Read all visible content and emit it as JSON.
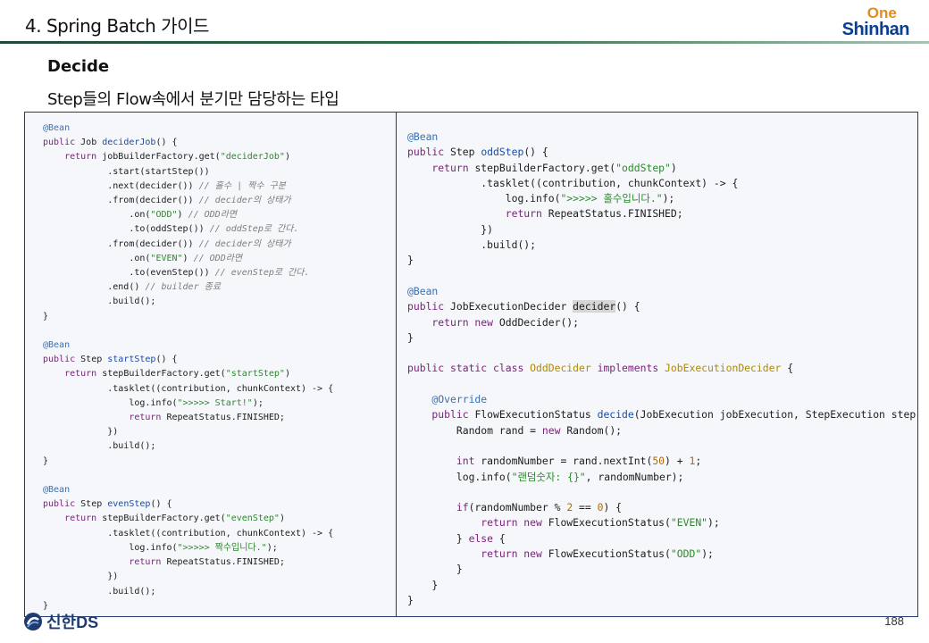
{
  "header": {
    "title": "4. Spring Batch 가이드",
    "logo_top": "One",
    "logo_bottom": "Shinhan",
    "rule_color": "#2f6e4c"
  },
  "section": {
    "heading": "Decide",
    "subtitle": "Step들의 Flow속에서 분기만 담당하는 타입"
  },
  "code_left": [
    [
      [
        "@Bean",
        "ann"
      ]
    ],
    [
      [
        "public ",
        "kw"
      ],
      [
        "Job ",
        ""
      ],
      [
        "deciderJob",
        "fn"
      ],
      [
        "() {",
        ""
      ]
    ],
    [
      [
        "    return ",
        "kw"
      ],
      [
        "jobBuilderFactory.get(",
        ""
      ],
      [
        "\"deciderJob\"",
        "str"
      ],
      [
        ")",
        ""
      ]
    ],
    [
      [
        "            .start(startStep())",
        ""
      ]
    ],
    [
      [
        "            .next(decider()) ",
        ""
      ],
      [
        "// 홀수 | 짝수 구분",
        "cmt"
      ]
    ],
    [
      [
        "            .from(decider()) ",
        ""
      ],
      [
        "// decider의 상태가",
        "cmt"
      ]
    ],
    [
      [
        "                .on(",
        ""
      ],
      [
        "\"ODD\"",
        "str"
      ],
      [
        ") ",
        ""
      ],
      [
        "// ODD라면",
        "cmt"
      ]
    ],
    [
      [
        "                .to(oddStep()) ",
        ""
      ],
      [
        "// oddStep로 간다.",
        "cmt"
      ]
    ],
    [
      [
        "            .from(decider()) ",
        ""
      ],
      [
        "// decider의 상태가",
        "cmt"
      ]
    ],
    [
      [
        "                .on(",
        ""
      ],
      [
        "\"EVEN\"",
        "str"
      ],
      [
        ") ",
        ""
      ],
      [
        "// ODD라면",
        "cmt"
      ]
    ],
    [
      [
        "                .to(evenStep()) ",
        ""
      ],
      [
        "// evenStep로 간다.",
        "cmt"
      ]
    ],
    [
      [
        "            .end() ",
        ""
      ],
      [
        "// builder 종료",
        "cmt"
      ]
    ],
    [
      [
        "            .build();",
        ""
      ]
    ],
    [
      [
        "}",
        ""
      ]
    ],
    [
      [
        "",
        ""
      ]
    ],
    [
      [
        "@Bean",
        "ann"
      ]
    ],
    [
      [
        "public ",
        "kw"
      ],
      [
        "Step ",
        ""
      ],
      [
        "startStep",
        "fn"
      ],
      [
        "() {",
        ""
      ]
    ],
    [
      [
        "    return ",
        "kw"
      ],
      [
        "stepBuilderFactory.get(",
        ""
      ],
      [
        "\"startStep\"",
        "str"
      ],
      [
        ")",
        ""
      ]
    ],
    [
      [
        "            .tasklet((contribution, chunkContext) -> {",
        ""
      ]
    ],
    [
      [
        "                log.info(",
        ""
      ],
      [
        "\">>>>> Start!\"",
        "str"
      ],
      [
        ");",
        ""
      ]
    ],
    [
      [
        "                return ",
        "kw"
      ],
      [
        "RepeatStatus.FINISHED;",
        ""
      ]
    ],
    [
      [
        "            })",
        ""
      ]
    ],
    [
      [
        "            .build();",
        ""
      ]
    ],
    [
      [
        "}",
        ""
      ]
    ],
    [
      [
        "",
        ""
      ]
    ],
    [
      [
        "@Bean",
        "ann"
      ]
    ],
    [
      [
        "public ",
        "kw"
      ],
      [
        "Step ",
        ""
      ],
      [
        "evenStep",
        "fn"
      ],
      [
        "() {",
        ""
      ]
    ],
    [
      [
        "    return ",
        "kw"
      ],
      [
        "stepBuilderFactory.get(",
        ""
      ],
      [
        "\"evenStep\"",
        "str"
      ],
      [
        ")",
        ""
      ]
    ],
    [
      [
        "            .tasklet((contribution, chunkContext) -> {",
        ""
      ]
    ],
    [
      [
        "                log.info(",
        ""
      ],
      [
        "\">>>>> 짝수입니다.\"",
        "str"
      ],
      [
        ");",
        ""
      ]
    ],
    [
      [
        "                return ",
        "kw"
      ],
      [
        "RepeatStatus.FINISHED;",
        ""
      ]
    ],
    [
      [
        "            })",
        ""
      ]
    ],
    [
      [
        "            .build();",
        ""
      ]
    ],
    [
      [
        "}",
        ""
      ]
    ]
  ],
  "code_right": [
    [
      [
        "@Bean",
        "ann"
      ]
    ],
    [
      [
        "public ",
        "kw"
      ],
      [
        "Step ",
        ""
      ],
      [
        "oddStep",
        "fn"
      ],
      [
        "() {",
        ""
      ]
    ],
    [
      [
        "    return ",
        "kw"
      ],
      [
        "stepBuilderFactory.get(",
        ""
      ],
      [
        "\"oddStep\"",
        "str"
      ],
      [
        ")",
        ""
      ]
    ],
    [
      [
        "            .tasklet((contribution, chunkContext) -> {",
        ""
      ]
    ],
    [
      [
        "                log.info(",
        ""
      ],
      [
        "\">>>>> 홀수입니다.\"",
        "str"
      ],
      [
        ");",
        ""
      ]
    ],
    [
      [
        "                return ",
        "kw"
      ],
      [
        "RepeatStatus.FINISHED;",
        ""
      ]
    ],
    [
      [
        "            })",
        ""
      ]
    ],
    [
      [
        "            .build();",
        ""
      ]
    ],
    [
      [
        "}",
        ""
      ]
    ],
    [
      [
        "",
        ""
      ]
    ],
    [
      [
        "@Bean",
        "ann"
      ]
    ],
    [
      [
        "public ",
        "kw"
      ],
      [
        "JobExecutionDecider ",
        ""
      ],
      [
        "decider",
        "hl"
      ],
      [
        "() {",
        ""
      ]
    ],
    [
      [
        "    return new ",
        "kw"
      ],
      [
        "OddDecider();",
        ""
      ]
    ],
    [
      [
        "}",
        ""
      ]
    ],
    [
      [
        "",
        ""
      ]
    ],
    [
      [
        "public static class ",
        "kw"
      ],
      [
        "OddDecider ",
        "cls"
      ],
      [
        "implements ",
        "kw"
      ],
      [
        "JobExecutionDecider ",
        "cls"
      ],
      [
        "{",
        ""
      ]
    ],
    [
      [
        "",
        ""
      ]
    ],
    [
      [
        "    @Override",
        "ann"
      ]
    ],
    [
      [
        "    public ",
        "kw"
      ],
      [
        "FlowExecutionStatus ",
        ""
      ],
      [
        "decide",
        "fn"
      ],
      [
        "(JobExecution jobExecution, StepExecution stepExecution) {",
        ""
      ]
    ],
    [
      [
        "        Random rand = ",
        ""
      ],
      [
        "new ",
        "kw"
      ],
      [
        "Random();",
        ""
      ]
    ],
    [
      [
        "",
        ""
      ]
    ],
    [
      [
        "        int ",
        "kw"
      ],
      [
        "randomNumber = rand.nextInt(",
        ""
      ],
      [
        "50",
        "num"
      ],
      [
        ") + ",
        ""
      ],
      [
        "1",
        "num"
      ],
      [
        ";",
        ""
      ]
    ],
    [
      [
        "        log.info(",
        ""
      ],
      [
        "\"랜덤숫자: {}\"",
        "str"
      ],
      [
        ", randomNumber);",
        ""
      ]
    ],
    [
      [
        "",
        ""
      ]
    ],
    [
      [
        "        if",
        "kw"
      ],
      [
        "(randomNumber % ",
        ""
      ],
      [
        "2",
        "num"
      ],
      [
        " == ",
        ""
      ],
      [
        "0",
        "num"
      ],
      [
        ") {",
        ""
      ]
    ],
    [
      [
        "            return new ",
        "kw"
      ],
      [
        "FlowExecutionStatus(",
        ""
      ],
      [
        "\"EVEN\"",
        "str"
      ],
      [
        ");",
        ""
      ]
    ],
    [
      [
        "        } ",
        ""
      ],
      [
        "else ",
        "kw"
      ],
      [
        "{",
        ""
      ]
    ],
    [
      [
        "            return new ",
        "kw"
      ],
      [
        "FlowExecutionStatus(",
        ""
      ],
      [
        "\"ODD\"",
        "str"
      ],
      [
        ");",
        ""
      ]
    ],
    [
      [
        "        }",
        ""
      ]
    ],
    [
      [
        "    }",
        ""
      ]
    ],
    [
      [
        "}",
        ""
      ]
    ]
  ],
  "footer": {
    "company": "신한DS",
    "page_number": "188"
  }
}
